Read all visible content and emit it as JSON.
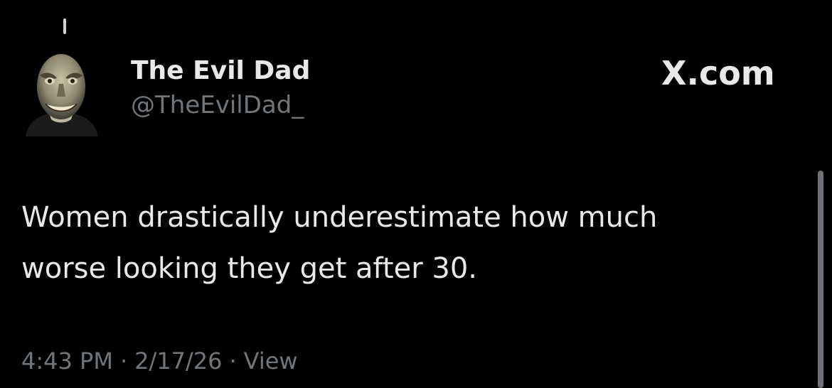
{
  "author": {
    "display_name": "The Evil Dad",
    "handle": "@TheEvilDad_",
    "avatar_icon": "avatar-grinning-face"
  },
  "site": {
    "label": "X.com"
  },
  "tweet": {
    "line1": "Women drastically underestimate how much",
    "line2": "worse looking they get after 30."
  },
  "meta": {
    "time": "4:43 PM",
    "separator": "·",
    "date": "2/17/26",
    "views_label": "View"
  },
  "colors": {
    "background": "#000000",
    "primary_text": "#e7e9ea",
    "secondary_text": "#71767b"
  }
}
